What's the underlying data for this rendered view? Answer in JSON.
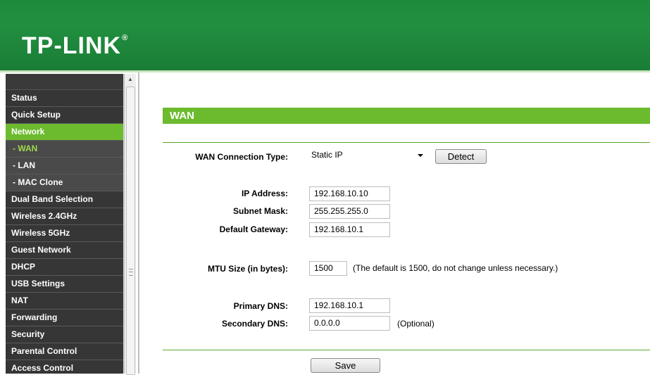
{
  "brand": {
    "logo_text": "TP-LINK",
    "registered_mark": "®"
  },
  "colors": {
    "header_green": "#1e8a3c",
    "accent_green": "#6cbb2e",
    "menu_dark": "#363636"
  },
  "sidebar": {
    "items": [
      {
        "label": "Status",
        "type": "main",
        "state": "normal"
      },
      {
        "label": "Quick Setup",
        "type": "main",
        "state": "normal"
      },
      {
        "label": "Network",
        "type": "main",
        "state": "active"
      },
      {
        "label": "- WAN",
        "type": "sub",
        "state": "current"
      },
      {
        "label": "- LAN",
        "type": "sub",
        "state": "normal"
      },
      {
        "label": "- MAC Clone",
        "type": "sub",
        "state": "normal"
      },
      {
        "label": "Dual Band Selection",
        "type": "main",
        "state": "normal"
      },
      {
        "label": "Wireless 2.4GHz",
        "type": "main",
        "state": "normal"
      },
      {
        "label": "Wireless 5GHz",
        "type": "main",
        "state": "normal"
      },
      {
        "label": "Guest Network",
        "type": "main",
        "state": "normal"
      },
      {
        "label": "DHCP",
        "type": "main",
        "state": "normal"
      },
      {
        "label": "USB Settings",
        "type": "main",
        "state": "normal"
      },
      {
        "label": "NAT",
        "type": "main",
        "state": "normal"
      },
      {
        "label": "Forwarding",
        "type": "main",
        "state": "normal"
      },
      {
        "label": "Security",
        "type": "main",
        "state": "normal"
      },
      {
        "label": "Parental Control",
        "type": "main",
        "state": "normal"
      },
      {
        "label": "Access Control",
        "type": "main",
        "state": "normal"
      }
    ]
  },
  "main": {
    "section_title": "WAN",
    "connection_type": {
      "label": "WAN Connection Type:",
      "value": "Static IP",
      "detect_label": "Detect"
    },
    "ip_address": {
      "label": "IP Address:",
      "value": "192.168.10.10"
    },
    "subnet_mask": {
      "label": "Subnet Mask:",
      "value": "255.255.255.0"
    },
    "default_gateway": {
      "label": "Default Gateway:",
      "value": "192.168.10.1"
    },
    "mtu": {
      "label": "MTU Size (in bytes):",
      "value": "1500",
      "note": "(The default is 1500, do not change unless necessary.)"
    },
    "primary_dns": {
      "label": "Primary DNS:",
      "value": "192.168.10.1"
    },
    "secondary_dns": {
      "label": "Secondary DNS:",
      "value": "0.0.0.0",
      "note": "(Optional)"
    },
    "save_label": "Save"
  }
}
